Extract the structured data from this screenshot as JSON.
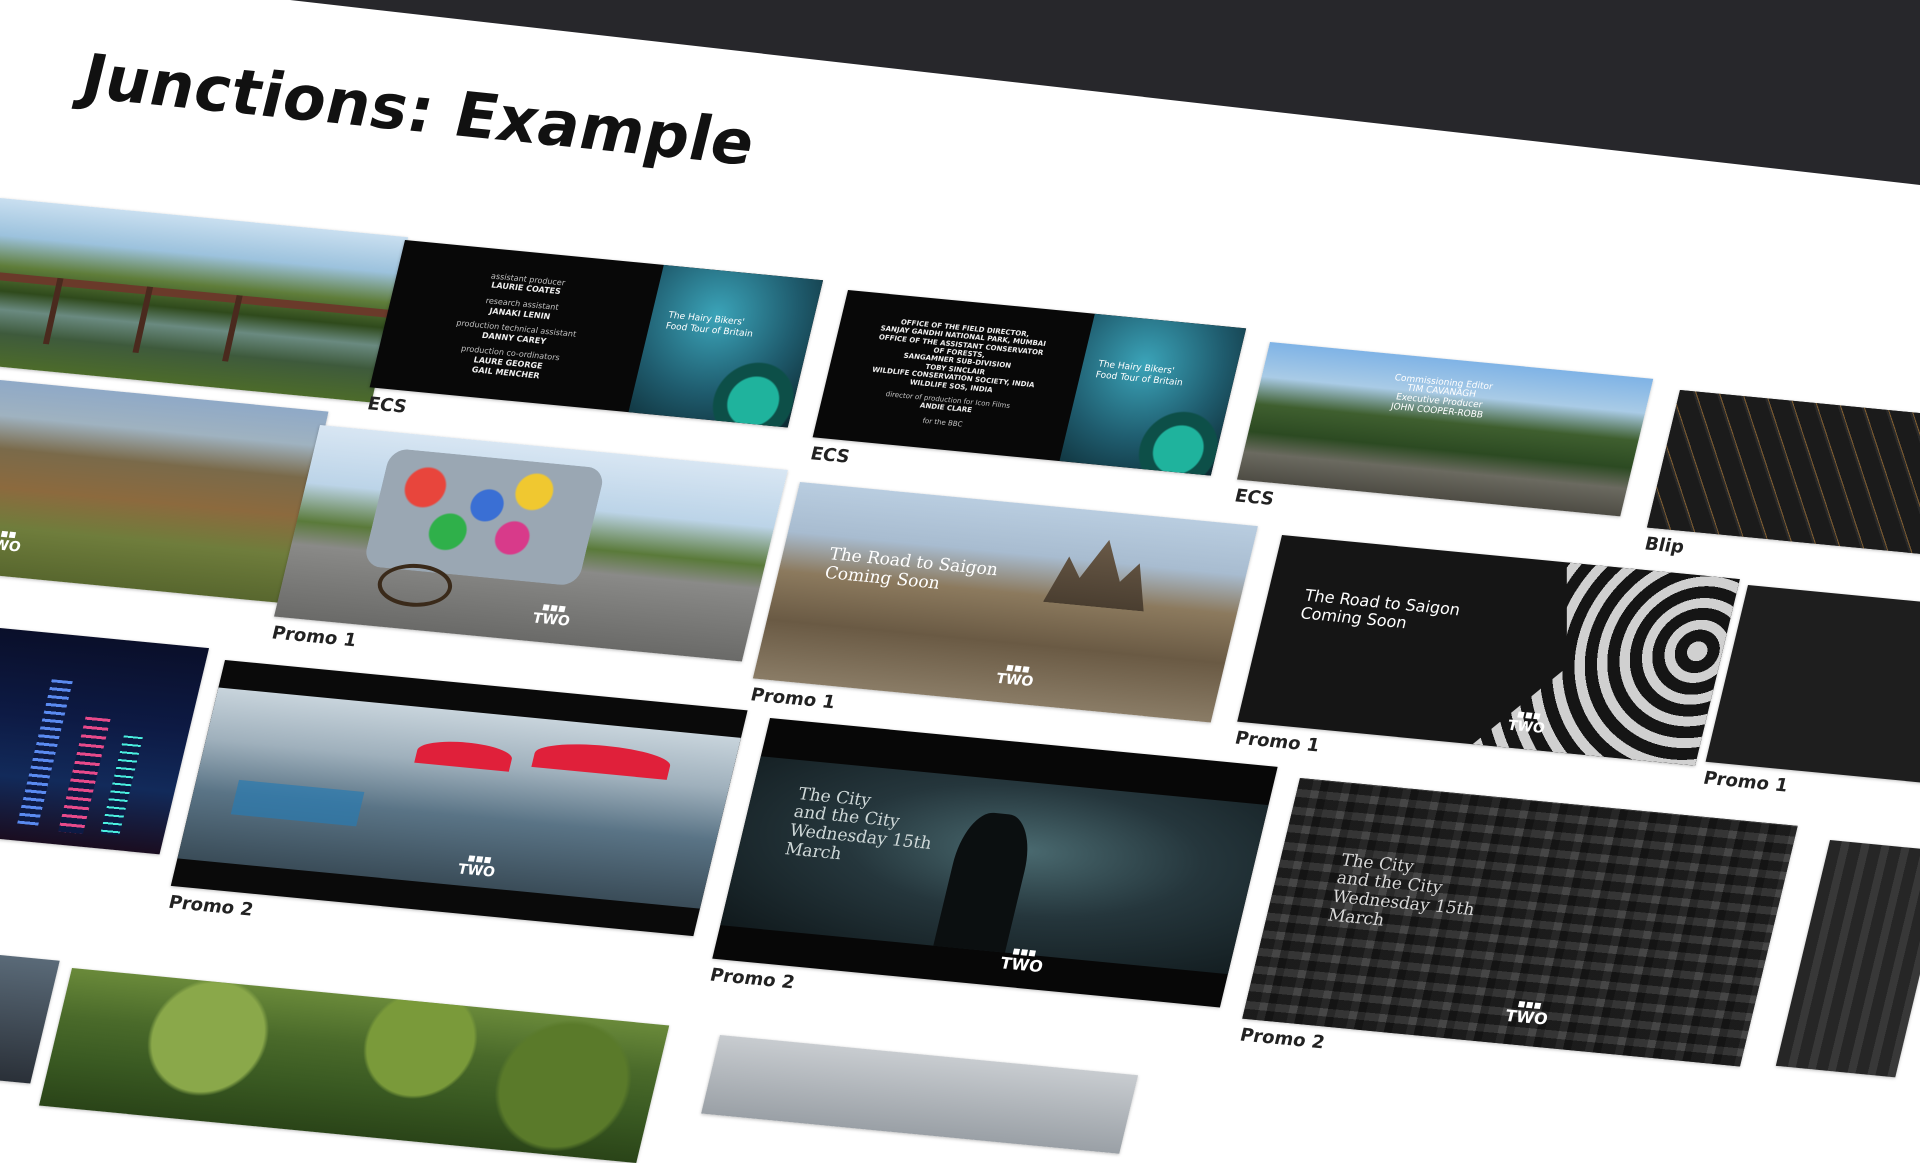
{
  "page": {
    "title": "Junctions: Example"
  },
  "colors": {
    "background": "#ffffff",
    "dark_header": "#27272b",
    "title_text": "#111111",
    "caption_text": "#222222"
  },
  "brand": {
    "logo_text": "BBC",
    "channel": "TWO"
  },
  "tiles": {
    "ecs_a": {
      "caption": "ECS",
      "credits": [
        {
          "role": "assistant producer",
          "name": "LAURIE COATES"
        },
        {
          "role": "research assistant",
          "name": "JANAKI LENIN"
        },
        {
          "role": "production technical assistant",
          "name": "DANNY CAREY"
        },
        {
          "role": "production co-ordinators",
          "name": "LAURE GEORGE\nGAIL MENCHER"
        }
      ],
      "side_text": "The Hairy Bikers'\nFood Tour of Britain"
    },
    "ecs_b": {
      "caption": "ECS",
      "credits": [
        {
          "role": "",
          "name": "OFFICE OF THE FIELD DIRECTOR,\nSANJAY GANDHI NATIONAL PARK, MUMBAI\nOFFICE OF THE ASSISTANT CONSERVATOR\nOF FORESTS,\nSANGAMNER SUB-DIVISION\nTOBY SINCLAIR\nWILDLIFE CONSERVATION SOCIETY, INDIA\nWILDLIFE SOS, INDIA"
        },
        {
          "role": "director of production for Icon Films",
          "name": "ANDIE CLARE"
        },
        {
          "role": "for the BBC",
          "name": ""
        }
      ],
      "side_text": "The Hairy Bikers'\nFood Tour of Britain"
    },
    "ecs_c": {
      "caption": "ECS",
      "overlay": "Commissioning Editor\nTIM CAVANAGH\nExecutive Producer\nJOHN COOPER-ROBB"
    },
    "blip": {
      "caption": "Blip"
    },
    "promo1_a": {
      "caption": "Promo 1"
    },
    "promo1_b": {
      "caption": "Promo 1",
      "overlay": "The Road to Saigon\nComing Soon"
    },
    "promo1_c": {
      "caption": "Promo 1",
      "overlay": "The Road to Saigon\nComing Soon"
    },
    "promo1_d": {
      "caption": "Promo 1"
    },
    "promo2_a": {
      "caption": "Promo 2"
    },
    "promo2_b": {
      "caption": "Promo 2",
      "overlay": "The City\nand the City\nWednesday 15th\nMarch"
    },
    "promo2_c": {
      "caption": "Promo 2",
      "overlay": "The City\nand the City\nWednesday 15th\nMarch"
    }
  }
}
